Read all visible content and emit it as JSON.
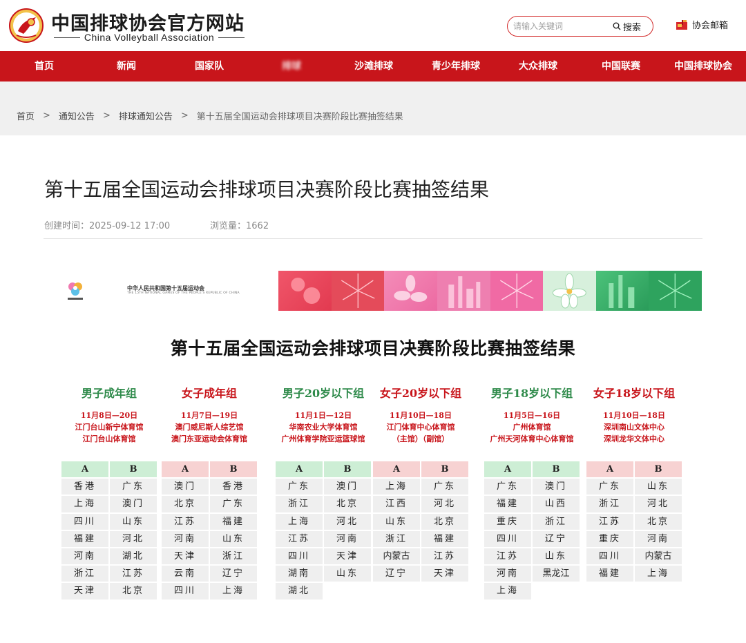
{
  "header": {
    "site_title": "中国排球协会官方网站",
    "site_subtitle": "China Volleyball Association",
    "search_placeholder": "请输入关键词",
    "search_label": "搜索",
    "mail_label": "协会邮箱"
  },
  "nav": {
    "items": [
      "首页",
      "新闻",
      "国家队",
      "排球",
      "沙滩排球",
      "青少年排球",
      "大众排球",
      "中国联赛",
      "中国排球协会"
    ]
  },
  "breadcrumb": [
    "首页",
    "通知公告",
    "排球通知公告",
    "第十五届全国运动会排球项目决赛阶段比赛抽签结果"
  ],
  "article": {
    "title": "第十五届全国运动会排球项目决赛阶段比赛抽签结果",
    "created": "创建时间：2025-09-12 17:00",
    "views": "浏览量：1662"
  },
  "poster": {
    "games_name": "中华人民共和国第十五届运动会",
    "games_name_en": "THE 15TH NATIONAL GAMES OF THE PEOPLE'S REPUBLIC OF CHINA",
    "title": "第十五届全国运动会排球项目决赛阶段比赛抽签结果",
    "groups": [
      {
        "name": "男子成年组",
        "info": [
          "11月8日—20日",
          "江门台山新宁体育馆",
          "江门台山体育馆"
        ],
        "A": [
          "香港",
          "上海",
          "四川",
          "福建",
          "河南",
          "浙江",
          "天津"
        ],
        "B": [
          "广东",
          "澳门",
          "山东",
          "河北",
          "湖北",
          "江苏",
          "北京"
        ]
      },
      {
        "name": "女子成年组",
        "info": [
          "11月7日—19日",
          "澳门威尼斯人综艺馆",
          "澳门东亚运动会体育馆"
        ],
        "A": [
          "澳门",
          "北京",
          "江苏",
          "河南",
          "天津",
          "云南",
          "四川"
        ],
        "B": [
          "香港",
          "广东",
          "福建",
          "山东",
          "浙江",
          "辽宁",
          "上海"
        ]
      },
      {
        "name": "男子20岁以下组",
        "info": [
          "11月1日—12日",
          "华南农业大学体育馆",
          "广州体育学院亚运篮球馆"
        ],
        "A": [
          "广东",
          "浙江",
          "上海",
          "江苏",
          "四川",
          "湖南",
          "湖北"
        ],
        "B": [
          "澳门",
          "北京",
          "河北",
          "河南",
          "天津",
          "山东"
        ]
      },
      {
        "name": "女子20岁以下组",
        "info": [
          "11月10日—18日",
          "江门体育中心体育馆",
          "（主馆）（副馆）"
        ],
        "A": [
          "上海",
          "江西",
          "山东",
          "浙江",
          "内蒙古",
          "辽宁"
        ],
        "B": [
          "广东",
          "河北",
          "北京",
          "福建",
          "江苏",
          "天津"
        ]
      },
      {
        "name": "男子18岁以下组",
        "info": [
          "11月5日—16日",
          "广州体育馆",
          "广州天河体育中心体育馆"
        ],
        "A": [
          "广东",
          "福建",
          "重庆",
          "四川",
          "江苏",
          "河南",
          "上海"
        ],
        "B": [
          "澳门",
          "山西",
          "浙江",
          "辽宁",
          "山东",
          "黑龙江"
        ]
      },
      {
        "name": "女子18岁以下组",
        "info": [
          "11月10日—18日",
          "深圳南山文体中心",
          "深圳龙华文体中心"
        ],
        "A": [
          "广东",
          "浙江",
          "江苏",
          "重庆",
          "四川",
          "福建"
        ],
        "B": [
          "山东",
          "河北",
          "北京",
          "河南",
          "内蒙古",
          "上海"
        ]
      }
    ],
    "column_labels": [
      "A",
      "B"
    ]
  },
  "colors": {
    "brand_red": "#c8151b",
    "men_green": "#2e8a4a",
    "men_header_bg": "#cdeed5",
    "women_header_bg": "#f7d2d2"
  }
}
